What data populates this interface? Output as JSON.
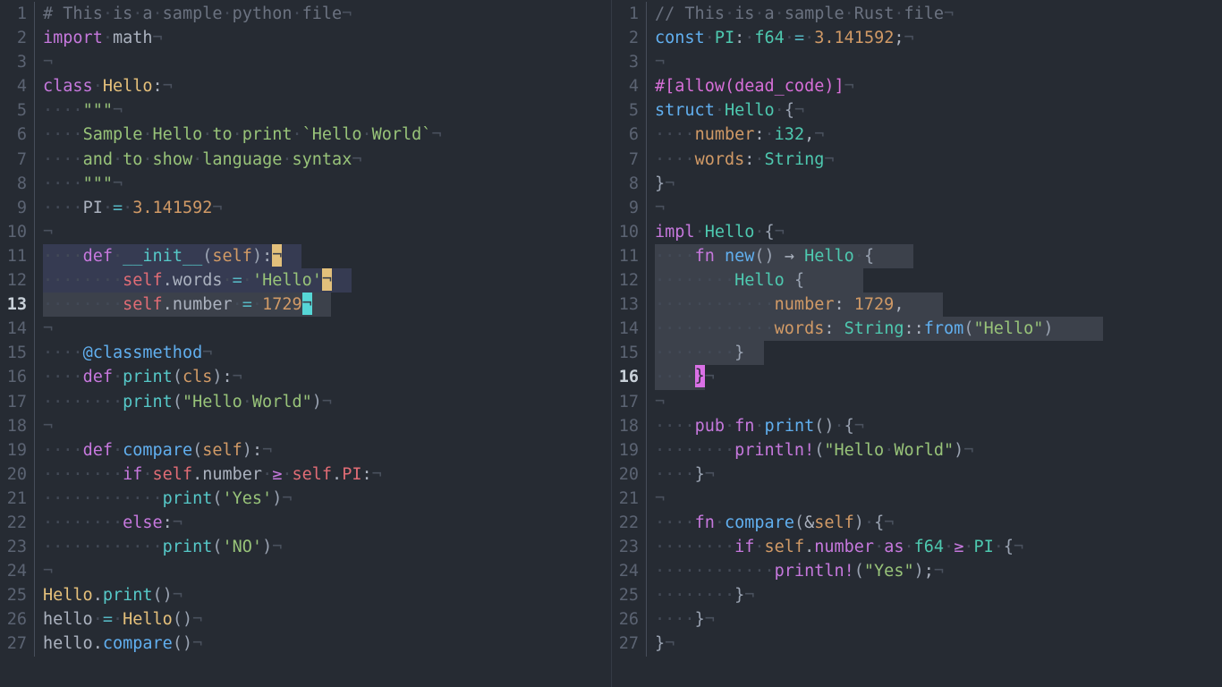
{
  "app": {
    "kind": "code-editor",
    "layout": "split-two-pane",
    "background": "#262b33",
    "font": "monospace-with-ligatures"
  },
  "theme": {
    "bg": "#262b33",
    "gutter_fg": "#5b6372",
    "gutter_active_fg": "#c9d1d9",
    "selection_purple": "#363b52",
    "selection_gray": "#3c414b",
    "cursor_tan": "#e3c07b",
    "cursor_cyan": "#56d6d6",
    "cursor_magenta": "#da70e6",
    "comment": "#6b7280",
    "keyword": "#c678dd",
    "function": "#61afef",
    "builtin": "#56c8c8",
    "class": "#e5c07b",
    "type": "#4ec9b0",
    "string": "#98c379",
    "number": "#d19a66",
    "operator": "#56b6c2",
    "variable": "#abb2bf",
    "self": "#e06c75",
    "property": "#d19a66",
    "attribute": "#d76fd8",
    "whitespace_dot": "#434a57",
    "eol_marker": "#4a515e"
  },
  "panes": [
    {
      "id": "left-pane",
      "language": "python",
      "active_line": 13,
      "total_lines": 27,
      "line_numbers": [
        1,
        2,
        3,
        4,
        5,
        6,
        7,
        8,
        9,
        10,
        11,
        12,
        13,
        14,
        15,
        16,
        17,
        18,
        19,
        20,
        21,
        22,
        23,
        24,
        25,
        26,
        27
      ],
      "lines": [
        "# This is a sample python file",
        "import math",
        "",
        "class Hello:",
        "    \"\"\"",
        "    Sample Hello to print `Hello World`",
        "    and to show language syntax",
        "    \"\"\"",
        "    PI = 3.141592",
        "",
        "    def __init__(self):",
        "        self.words = 'Hello'",
        "        self.number = 1729",
        "",
        "    @classmethod",
        "    def print(cls):",
        "        print(\"Hello World\")",
        "",
        "    def compare(self):",
        "        if self.number >= self.PI:",
        "            print('Yes')",
        "        else:",
        "            print('NO')",
        "",
        "Hello.print()",
        "hello = Hello()",
        "hello.compare()"
      ],
      "selections": [
        {
          "line": 11,
          "style": "purple"
        },
        {
          "line": 12,
          "style": "purple"
        },
        {
          "line": 13,
          "style": "gray"
        }
      ],
      "cursors": [
        {
          "line": 11,
          "column": 24,
          "color": "tan",
          "label": "secondary-cursor"
        },
        {
          "line": 12,
          "column": 29,
          "color": "tan",
          "label": "secondary-cursor"
        },
        {
          "line": 13,
          "column": 27,
          "color": "cyan",
          "label": "primary-cursor"
        }
      ]
    },
    {
      "id": "right-pane",
      "language": "rust",
      "active_line": 16,
      "total_lines": 27,
      "line_numbers": [
        1,
        2,
        3,
        4,
        5,
        6,
        7,
        8,
        9,
        10,
        11,
        12,
        13,
        14,
        15,
        16,
        17,
        18,
        19,
        20,
        21,
        22,
        23,
        24,
        25,
        26,
        27
      ],
      "lines": [
        "// This is a sample Rust file",
        "const PI: f64 = 3.141592;",
        "",
        "#[allow(dead_code)]",
        "struct Hello {",
        "    number: i32,",
        "    words: String",
        "}",
        "",
        "impl Hello {",
        "    fn new() -> Hello {",
        "        Hello {",
        "            number: 1729,",
        "            words: String::from(\"Hello\")",
        "        }",
        "    }",
        "",
        "    pub fn print() {",
        "        println!(\"Hello World\")",
        "    }",
        "",
        "    fn compare(&self) {",
        "        if self.number as f64 >= PI {",
        "            println!(\"Yes\");",
        "        }",
        "    }",
        "}"
      ],
      "selections": [
        {
          "line": 11,
          "style": "gray"
        },
        {
          "line": 12,
          "style": "gray"
        },
        {
          "line": 13,
          "style": "gray"
        },
        {
          "line": 14,
          "style": "gray"
        },
        {
          "line": 15,
          "style": "gray"
        },
        {
          "line": 16,
          "style": "gray"
        }
      ],
      "cursors": [
        {
          "line": 16,
          "column": 5,
          "color": "magenta",
          "label": "primary-cursor",
          "glyph": "}"
        }
      ]
    }
  ],
  "ligatures": {
    "greater_equal": "≥",
    "arrow_right": "→"
  },
  "markers": {
    "eol": "¬",
    "space": "·"
  }
}
